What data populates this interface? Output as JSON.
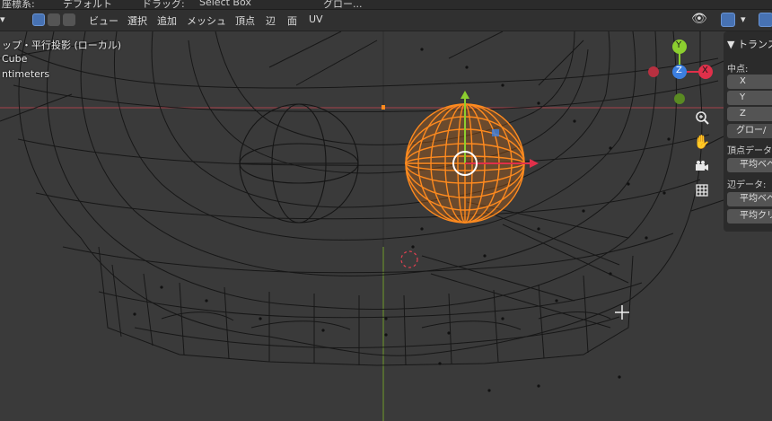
{
  "top_bar": {
    "coord_label": "座標系:",
    "orientation_value": "デフォルト",
    "drag_label": "ドラッグ:",
    "drag_value": "Select Box",
    "pivot_value": "グロー..."
  },
  "header": {
    "menus": [
      "ビュー",
      "選択",
      "追加",
      "メッシュ",
      "頂点",
      "辺",
      "面",
      "UV"
    ]
  },
  "viewport": {
    "view_name": "ップ・平行投影 (ローカル)",
    "object_name": "Cube",
    "units": "ntimeters"
  },
  "gizmo": {
    "y_label": "Y",
    "z_label": "Z",
    "x_label": "X"
  },
  "nav_buttons": [
    "zoom-icon",
    "hand-icon",
    "camera-icon",
    "grid-icon"
  ],
  "npanel": {
    "title": "▼ トランス",
    "median_label": "中点:",
    "fields": [
      "X",
      "Y",
      "Z"
    ],
    "global_button": "グロー/",
    "vertex_data_label": "頂点データ",
    "vertex_button": "平均ベベ",
    "edge_data_label": "辺データ:",
    "edge_buttons": [
      "平均ベベ",
      "平均クリ"
    ]
  },
  "colors": {
    "selected": "#ff8a1e",
    "axis_x": "#e0304a",
    "axis_y": "#8ccf2f",
    "axis_z": "#3c7fe0",
    "accent": "#4772b3"
  }
}
